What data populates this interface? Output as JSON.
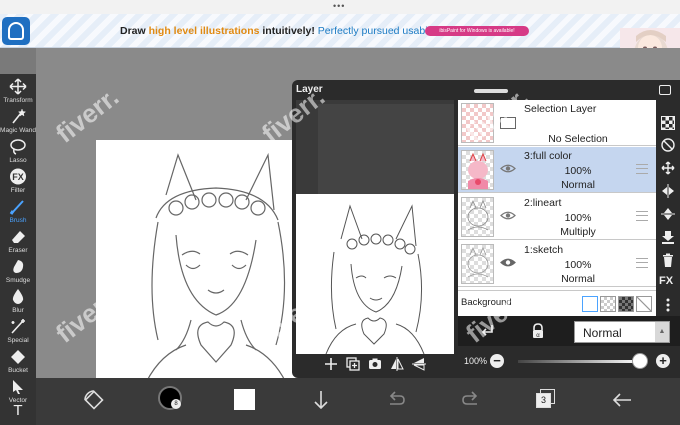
{
  "ad": {
    "part1": "Draw ",
    "part2": "high level illustrations",
    "part3": " intuitively! ",
    "part4": "Perfectly pursued usability!",
    "pill": "ibisPaint for Windows is available!"
  },
  "tools": [
    {
      "label": "Transform",
      "icon": "transform-icon"
    },
    {
      "label": "Magic Wand",
      "icon": "magic-wand-icon"
    },
    {
      "label": "Lasso",
      "icon": "lasso-icon"
    },
    {
      "label": "Filter",
      "icon": "filter-icon"
    },
    {
      "label": "Brush",
      "icon": "brush-icon"
    },
    {
      "label": "Eraser",
      "icon": "eraser-icon"
    },
    {
      "label": "Smudge",
      "icon": "smudge-icon"
    },
    {
      "label": "Blur",
      "icon": "blur-icon"
    },
    {
      "label": "Special",
      "icon": "special-icon"
    },
    {
      "label": "Bucket",
      "icon": "bucket-icon"
    },
    {
      "label": "Vector",
      "icon": "vector-icon"
    },
    {
      "label": "T",
      "icon": "text-icon"
    }
  ],
  "layer_panel": {
    "title": "Layer",
    "selection_layer": {
      "name": "Selection Layer",
      "status": "No Selection"
    },
    "layers": [
      {
        "name": "3:full color",
        "opacity": "100%",
        "blend": "Normal",
        "selected": true
      },
      {
        "name": "2:lineart",
        "opacity": "100%",
        "blend": "Multiply",
        "selected": false
      },
      {
        "name": "1:sketch",
        "opacity": "100%",
        "blend": "Normal",
        "selected": false
      }
    ],
    "background_label": "Background",
    "blend_mode": "Normal",
    "opacity": "100%",
    "opacity_value": 1.0,
    "fx_label": "FX"
  },
  "bottom_bar": {
    "layer_count": "3"
  },
  "watermark": "fiverr."
}
